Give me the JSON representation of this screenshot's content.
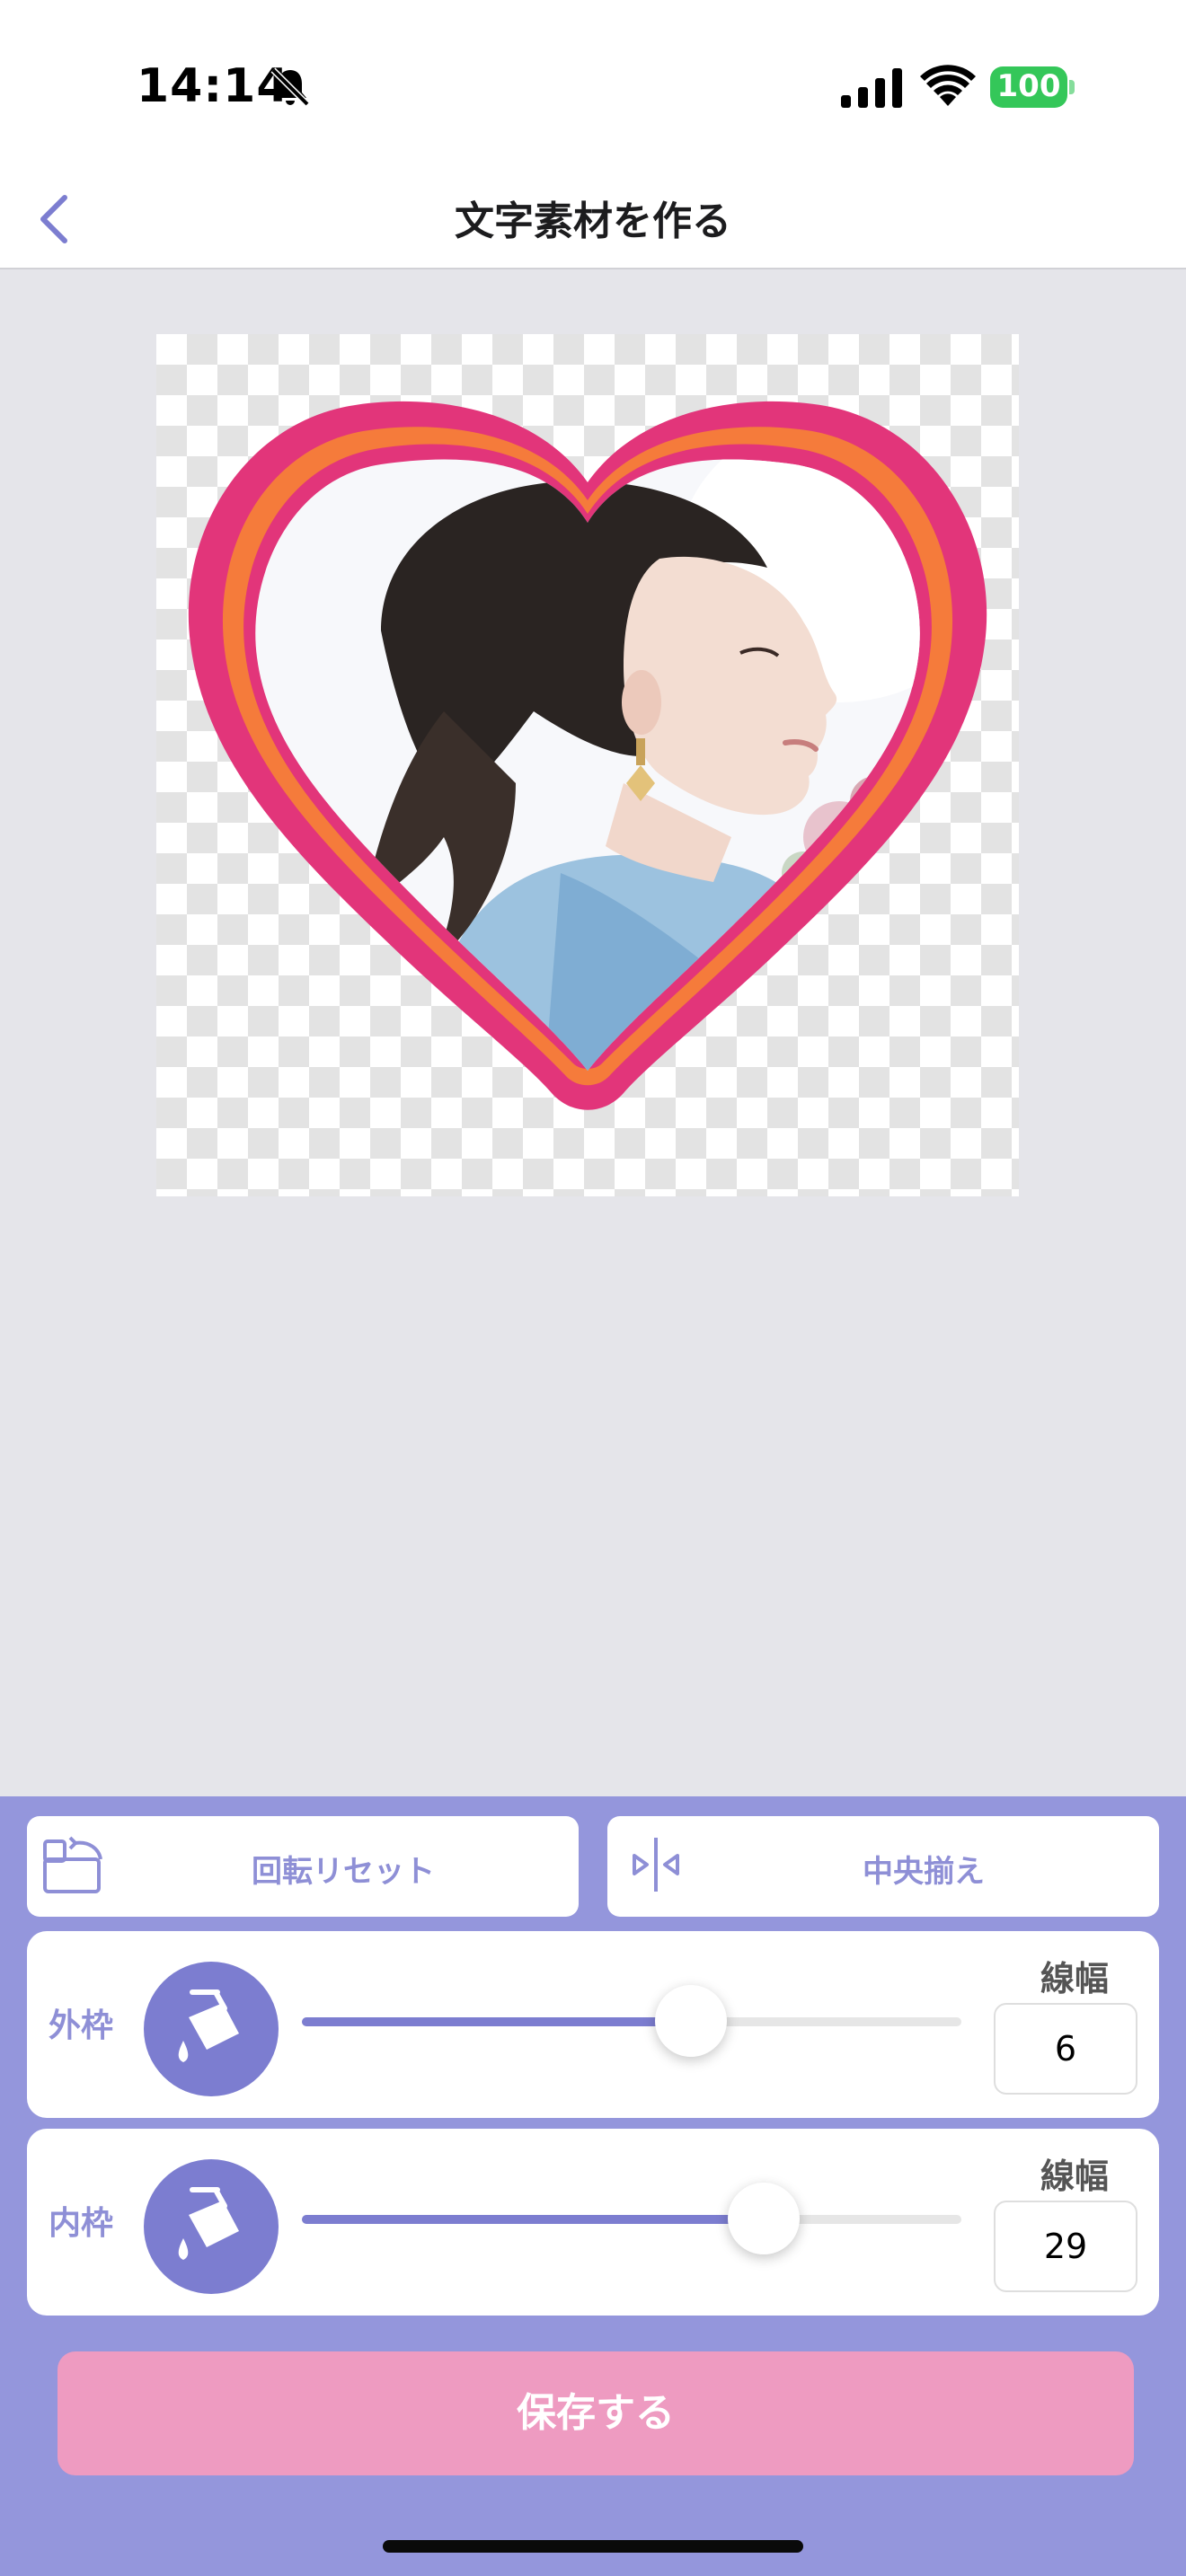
{
  "status_bar": {
    "time": "14:14",
    "battery": "100",
    "icons": [
      "bell-slash-icon",
      "cellular-signal-icon",
      "wifi-icon",
      "battery-icon"
    ]
  },
  "nav": {
    "title": "文字素材を作る",
    "back_icon": "chevron-left-icon"
  },
  "preview": {
    "frame_shape": "heart",
    "colors": {
      "outer_frame": "#e2357a",
      "inner_frame": "#f57b3b",
      "checker": "#e3e3e3"
    }
  },
  "toolbar": {
    "rotate_reset_label": "回転リセット",
    "center_align_label": "中央揃え"
  },
  "outer_frame_row": {
    "label": "外枠",
    "width_label": "線幅",
    "width_value": "6",
    "slider_level": 0.59
  },
  "inner_frame_row": {
    "label": "内枠",
    "width_label": "線幅",
    "width_value": "29",
    "slider_level": 0.7
  },
  "save_button_label": "保存する",
  "colors": {
    "accent": "#7c7dd0",
    "panel_bg": "#9496dc",
    "save_button": "#ee9bc1"
  }
}
